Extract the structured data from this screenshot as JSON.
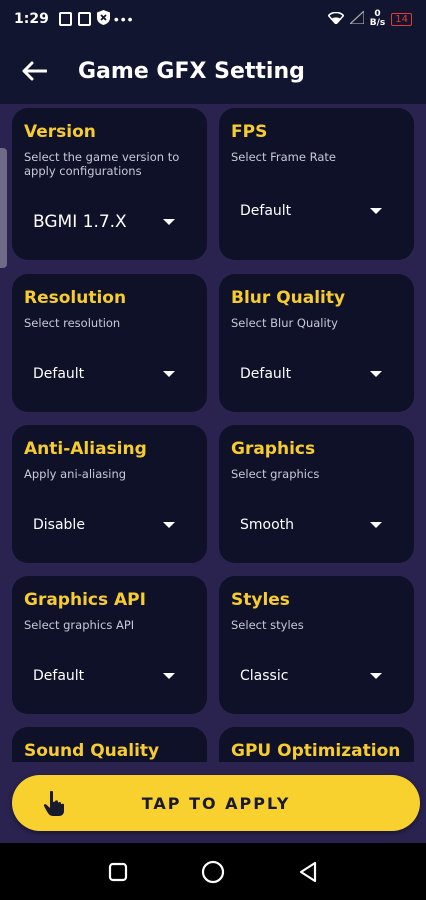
{
  "status": {
    "time": "1:29",
    "dots": "•••",
    "netspeed_value": "0",
    "netspeed_unit": "B/s",
    "battery": "14"
  },
  "header": {
    "title": "Game GFX Setting"
  },
  "cards": [
    {
      "title": "Version",
      "subtitle": "Select the game version to apply configurations",
      "value": "BGMI 1.7.X"
    },
    {
      "title": "FPS",
      "subtitle": "Select Frame Rate",
      "value": "Default"
    },
    {
      "title": "Resolution",
      "subtitle": "Select resolution",
      "value": "Default"
    },
    {
      "title": "Blur Quality",
      "subtitle": "Select Blur Quality",
      "value": "Default"
    },
    {
      "title": "Anti-Aliasing",
      "subtitle": "Apply ani-aliasing",
      "value": "Disable"
    },
    {
      "title": "Graphics",
      "subtitle": "Select graphics",
      "value": "Smooth"
    },
    {
      "title": "Graphics API",
      "subtitle": "Select graphics API",
      "value": "Default"
    },
    {
      "title": "Styles",
      "subtitle": "Select  styles",
      "value": "Classic"
    },
    {
      "title": "Sound Quality"
    },
    {
      "title": "GPU Optimization"
    }
  ],
  "apply_button": {
    "label": "TAP TO APPLY"
  },
  "colors": {
    "accent": "#f9d12f",
    "card_bg": "#0e1128",
    "page_bg": "#2a2350",
    "title_yellow": "#f7cc2f"
  }
}
